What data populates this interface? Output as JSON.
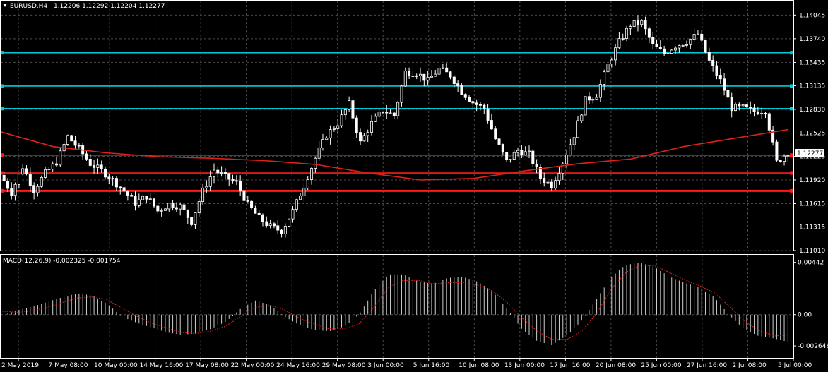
{
  "header": {
    "symbol_timeframe": "EURUSD,H4",
    "ohlc": "1.12206 1.12292 1.12204 1.12277"
  },
  "macd_header": "MACD(12,26,9) -0.002325 -0.001754",
  "colors": {
    "background": "#000000",
    "grid": "#4a4a4a",
    "frame": "#ffffff",
    "candle": "#ffffff",
    "horizontal_lines_cyan": "#00c8d8",
    "horizontal_lines_red": "#ff1a1a",
    "moving_average": "#e0201a",
    "price_label_bg": "#ffffff",
    "macd_hist": "#cfcfcf",
    "macd_signal": "#e02020"
  },
  "price_axis": {
    "ticks": [
      "1.14045",
      "1.13740",
      "1.13435",
      "1.13135",
      "1.12830",
      "1.12525",
      "1.12225",
      "1.11920",
      "1.11615",
      "1.11315",
      "1.11010"
    ],
    "current_price_label": "1.12277"
  },
  "macd_axis": {
    "ticks": [
      "0.00442",
      "0.00",
      "-0.002646"
    ]
  },
  "time_axis": {
    "labels": [
      "2 May 2019",
      "7 May 08:00",
      "10 May 00:00",
      "14 May 16:00",
      "17 May 08:00",
      "22 May 00:00",
      "24 May 16:00",
      "29 May 08:00",
      "3 Jun 00:00",
      "5 Jun 16:00",
      "10 Jun 08:00",
      "13 Jun 00:00",
      "17 Jun 16:00",
      "20 Jun 08:00",
      "25 Jun 00:00",
      "27 Jun 16:00",
      "2 Jul 08:00",
      "5 Jul 00:00"
    ]
  },
  "chart_data": [
    {
      "type": "candlestick",
      "title": "EURUSD,H4",
      "ylim": [
        1.1101,
        1.1423
      ],
      "horizontal_levels": [
        {
          "price": 1.1356,
          "color": "cyan"
        },
        {
          "price": 1.1313,
          "color": "cyan"
        },
        {
          "price": 1.1284,
          "color": "cyan"
        },
        {
          "price": 1.1224,
          "color": "red"
        },
        {
          "price": 1.1201,
          "color": "red"
        },
        {
          "price": 1.1178,
          "color": "red"
        }
      ],
      "moving_average": [
        1.1254,
        1.1235,
        1.1227,
        1.1222,
        1.122,
        1.1217,
        1.1212,
        1.1201,
        1.1192,
        1.1194,
        1.1204,
        1.1213,
        1.1219,
        1.1235,
        1.1246,
        1.1257
      ],
      "close_path": [
        1.1198,
        1.1176,
        1.1209,
        1.1179,
        1.1201,
        1.1215,
        1.1248,
        1.1232,
        1.1213,
        1.1204,
        1.1192,
        1.1178,
        1.1162,
        1.1171,
        1.1152,
        1.1161,
        1.1158,
        1.1138,
        1.1178,
        1.1205,
        1.1196,
        1.1188,
        1.116,
        1.1143,
        1.1132,
        1.1126,
        1.1152,
        1.1185,
        1.122,
        1.125,
        1.1265,
        1.129,
        1.124,
        1.1265,
        1.1282,
        1.1275,
        1.1331,
        1.133,
        1.132,
        1.1335,
        1.1327,
        1.1306,
        1.1292,
        1.1284,
        1.1245,
        1.1216,
        1.123,
        1.1225,
        1.1195,
        1.1185,
        1.1215,
        1.125,
        1.1295,
        1.1302,
        1.134,
        1.137,
        1.1392,
        1.1395,
        1.1365,
        1.1355,
        1.1365,
        1.137,
        1.138,
        1.1345,
        1.132,
        1.1285,
        1.1285,
        1.128,
        1.1282,
        1.1215,
        1.1228
      ]
    },
    {
      "type": "bar",
      "title": "MACD(12,26,9)",
      "ylim": [
        -0.003,
        0.0047
      ],
      "histogram": [
        0.0,
        0.0004,
        0.0007,
        0.0011,
        0.0015,
        0.0018,
        0.0016,
        0.0009,
        -0.0002,
        -0.0007,
        -0.0011,
        -0.0015,
        -0.0017,
        -0.0016,
        -0.0012,
        -0.0006,
        0.0005,
        0.0012,
        0.0008,
        -0.0002,
        -0.0009,
        -0.0013,
        -0.0014,
        -0.001,
        0.0,
        0.002,
        0.0034,
        0.0034,
        0.0028,
        0.0026,
        0.0031,
        0.0032,
        0.0028,
        0.002,
        0.0005,
        -0.0012,
        -0.0022,
        -0.0026,
        -0.0018,
        -0.0006,
        0.0012,
        0.0031,
        0.0042,
        0.0044,
        0.004,
        0.0032,
        0.0027,
        0.0023,
        0.0015,
        0.0,
        -0.0012,
        -0.0018,
        -0.002,
        -0.0023
      ],
      "signal": [
        0.0003,
        0.0002,
        0.0003,
        0.0006,
        0.001,
        0.0014,
        0.0015,
        0.0013,
        0.0006,
        -0.0001,
        -0.0007,
        -0.0011,
        -0.0015,
        -0.0016,
        -0.0014,
        -0.001,
        -0.0002,
        0.0006,
        0.0008,
        0.0004,
        -0.0003,
        -0.0008,
        -0.0012,
        -0.0012,
        -0.0008,
        0.0006,
        0.0023,
        0.0029,
        0.0029,
        0.0026,
        0.0027,
        0.0027,
        0.0025,
        0.002,
        0.001,
        -0.0003,
        -0.0014,
        -0.0021,
        -0.0021,
        -0.0014,
        0.0001,
        0.0022,
        0.0036,
        0.0042,
        0.0041,
        0.0035,
        0.0029,
        0.0024,
        0.0018,
        0.0006,
        -0.0006,
        -0.0014,
        -0.0018,
        -0.0017
      ]
    }
  ]
}
